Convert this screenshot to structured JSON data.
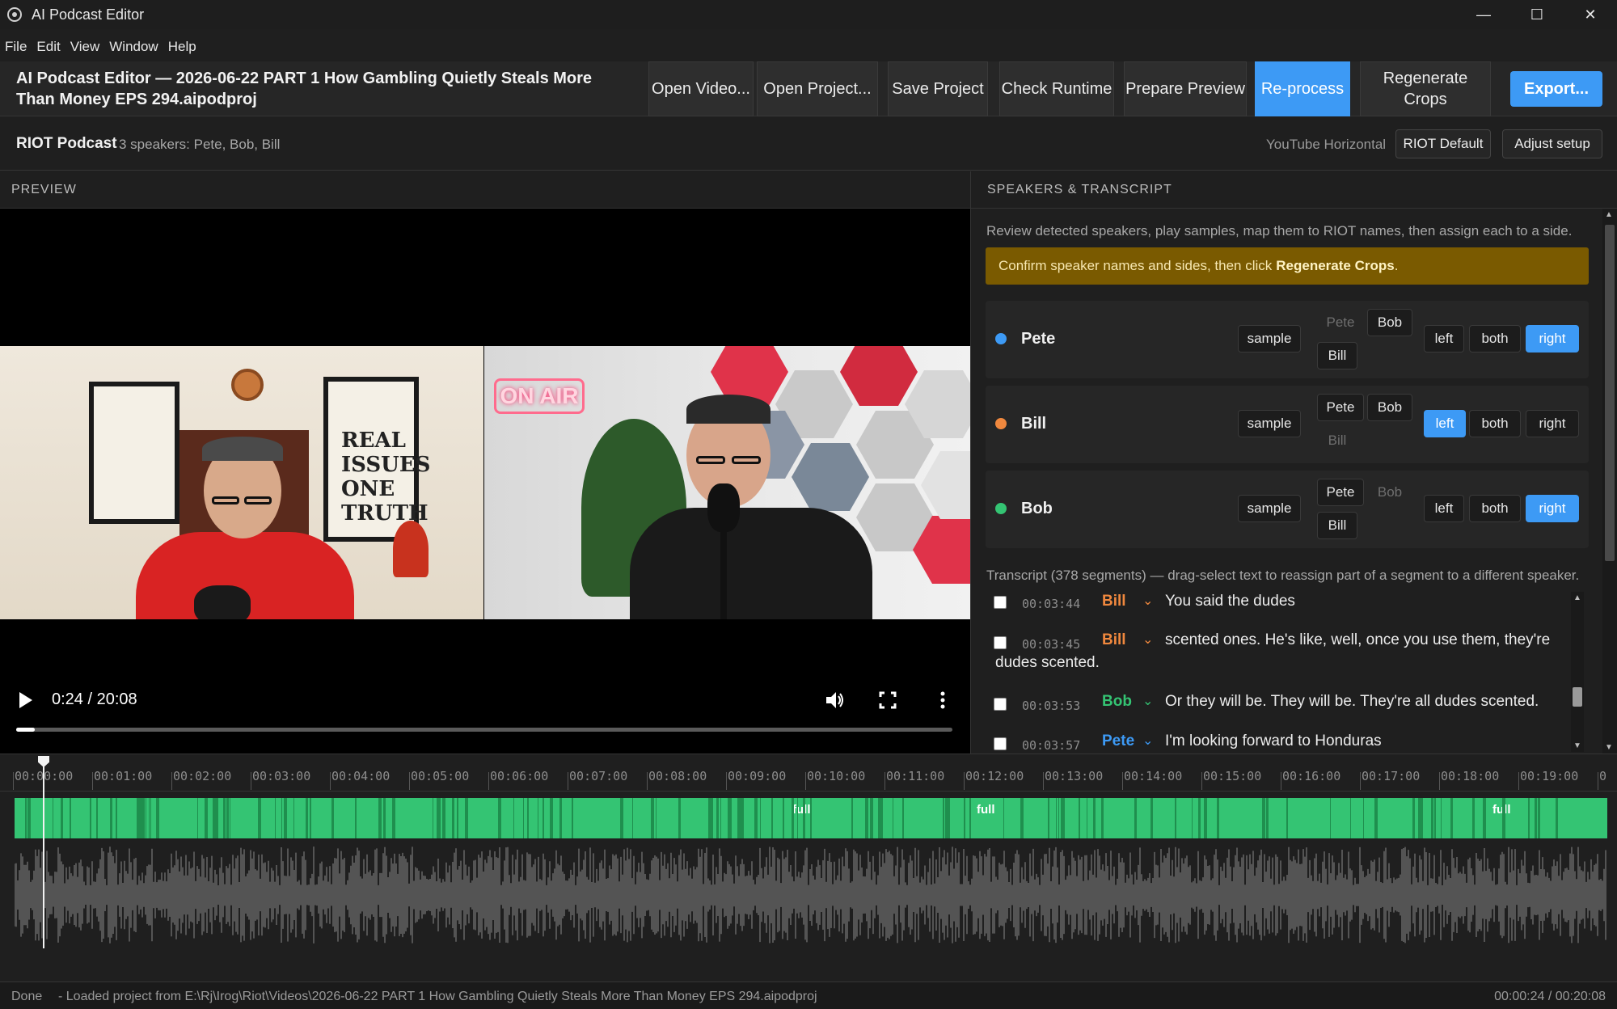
{
  "window": {
    "title": "AI Podcast Editor",
    "minimize": "—",
    "maximize": "☐",
    "close": "✕"
  },
  "menu": [
    "File",
    "Edit",
    "View",
    "Window",
    "Help"
  ],
  "toolbar": {
    "project_title": "AI Podcast Editor — 2026-06-22 PART 1 How Gambling Quietly Steals More Than Money EPS 294.aipodproj",
    "buttons": [
      {
        "label": "Open Video...",
        "name": "open-video-button"
      },
      {
        "label": "Open Project...",
        "name": "open-project-button"
      },
      {
        "label": "Save Project",
        "name": "save-project-button"
      },
      {
        "label": "Check Runtime",
        "name": "check-runtime-button"
      },
      {
        "label": "Prepare Preview",
        "name": "prepare-preview-button"
      },
      {
        "label": "Re-process",
        "name": "reprocess-button"
      },
      {
        "label": "Regenerate Crops",
        "name": "regenerate-crops-button"
      }
    ],
    "export_label": "Export...",
    "accent_color": "#3d9af5"
  },
  "preset": {
    "name": "RIOT Podcast",
    "speakers_summary": "3 speakers: Pete, Bob, Bill",
    "format": "YouTube Horizontal",
    "default_button": "RIOT Default",
    "adjust_button": "Adjust setup"
  },
  "preview": {
    "heading": "PREVIEW",
    "time": "0:24 / 20:08",
    "progress_fraction": 0.02,
    "neon_sign": "ON AIR",
    "poster_text": "REAL ISSUES ONE TRUTH"
  },
  "speakers_panel": {
    "heading": "SPEAKERS & TRANSCRIPT",
    "hint": "Review detected speakers, play samples, map them to RIOT names, then assign each to a side.",
    "banner_text": "Confirm speaker names and sides, then click",
    "banner_action": "Regenerate Crops",
    "banner_end": ".",
    "sample_label": "sample",
    "side_labels": [
      "left",
      "both",
      "right"
    ],
    "speakers": [
      {
        "name": "Pete",
        "color": "#3d9af5",
        "names": [
          "Pete",
          "Bob",
          "Bill"
        ],
        "current_name": "Pete",
        "side": "right"
      },
      {
        "name": "Bill",
        "color": "#f0883e",
        "names": [
          "Pete",
          "Bob",
          "Bill"
        ],
        "current_name": "Bill",
        "side": "left"
      },
      {
        "name": "Bob",
        "color": "#34c473",
        "names": [
          "Pete",
          "Bob",
          "Bill"
        ],
        "current_name": "Bob",
        "side": "right"
      }
    ],
    "transcript_hint": "Transcript (378 segments) — drag-select text to reassign part of a segment to a different speaker.",
    "segments": [
      {
        "time": "00:03:44",
        "speaker": "Bill",
        "color": "#f0883e",
        "text": "You said the dudes",
        "cont": ""
      },
      {
        "time": "00:03:45",
        "speaker": "Bill",
        "color": "#f0883e",
        "text": "scented ones. He's like, well, once you use them, they're",
        "cont": "dudes scented."
      },
      {
        "time": "00:03:53",
        "speaker": "Bob",
        "color": "#34c473",
        "text": "Or they will be. They will be. They're all dudes scented.",
        "cont": ""
      },
      {
        "time": "00:03:57",
        "speaker": "Pete",
        "color": "#3d9af5",
        "text": "I'm looking forward to Honduras",
        "cont": ""
      }
    ]
  },
  "timeline": {
    "ticks": [
      "00:00:00",
      "00:01:00",
      "00:02:00",
      "00:03:00",
      "00:04:00",
      "00:05:00",
      "00:06:00",
      "00:07:00",
      "00:08:00",
      "00:09:00",
      "00:10:00",
      "00:11:00",
      "00:12:00",
      "00:13:00",
      "00:14:00",
      "00:15:00",
      "00:16:00",
      "00:17:00",
      "00:18:00",
      "00:19:00",
      "0"
    ],
    "track_labels": [
      "full",
      "full",
      "full"
    ],
    "track_color": "#34c473"
  },
  "status": {
    "state": "Done",
    "message": "- Loaded project from E:\\Rj\\Irog\\Riot\\Videos\\2026-06-22 PART 1 How Gambling Quietly Steals More Than Money EPS 294.aipodproj",
    "time": "00:00:24 / 00:20:08"
  }
}
